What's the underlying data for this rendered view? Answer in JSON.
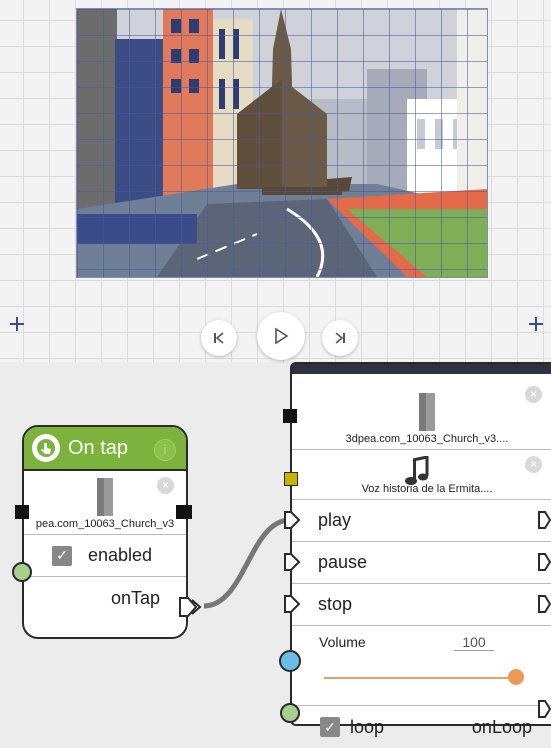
{
  "playback": {
    "prev_icon": "skip-previous-icon",
    "play_icon": "play-icon",
    "next_icon": "skip-next-icon"
  },
  "tap_node": {
    "title": "On tap",
    "title_icon": "tap-hand-icon",
    "info_icon": "info-icon",
    "object_label": "pea.com_10063_Church_v3",
    "object_icon": "church-object-icon",
    "enabled_label": "enabled",
    "enabled_checked": true,
    "output_label": "onTap"
  },
  "media_node": {
    "object_label": "3dpea.com_10063_Church_v3....",
    "object_icon": "church-object-icon",
    "audio_label": "Voz historia de la Ermita....",
    "audio_icon": "music-note-icon",
    "inputs": [
      "play",
      "pause",
      "stop"
    ],
    "volume_label": "Volume",
    "volume_value": "100",
    "volume_level": 1.0,
    "loop_label": "loop",
    "loop_output": "onLoop"
  },
  "colors": {
    "header_green": "#7bb33d",
    "port_green": "#a7d08c",
    "port_blue": "#6bbde9",
    "slider_orange": "#ee9a55",
    "audio_port": "#c6b400"
  }
}
